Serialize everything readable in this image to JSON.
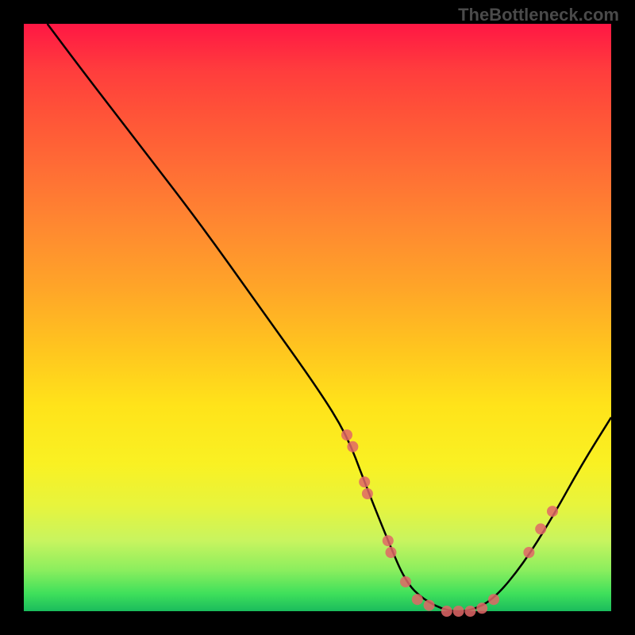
{
  "watermark": "TheBottleneck.com",
  "chart_data": {
    "type": "line",
    "title": "",
    "xlabel": "",
    "ylabel": "",
    "xlim": [
      0,
      100
    ],
    "ylim": [
      0,
      100
    ],
    "background_gradient": {
      "top": "#ff1744",
      "mid": "#ffe31a",
      "bottom": "#1abc5c"
    },
    "series": [
      {
        "name": "bottleneck-curve",
        "color": "#000000",
        "x": [
          4,
          10,
          20,
          30,
          40,
          50,
          55,
          58,
          62,
          65,
          68,
          72,
          76,
          80,
          85,
          90,
          95,
          100
        ],
        "y": [
          100,
          92,
          79,
          66,
          52,
          38,
          30,
          22,
          12,
          5,
          2,
          0,
          0,
          2,
          8,
          16,
          25,
          33
        ]
      }
    ],
    "scatter_points": {
      "name": "highlighted-points",
      "color": "#e06666",
      "x": [
        55,
        56,
        58,
        58.5,
        62,
        62.5,
        65,
        67,
        69,
        72,
        74,
        76,
        78,
        80,
        86,
        88,
        90
      ],
      "y": [
        30,
        28,
        22,
        20,
        12,
        10,
        5,
        2,
        1,
        0,
        0,
        0,
        0.5,
        2,
        10,
        14,
        17
      ]
    }
  }
}
